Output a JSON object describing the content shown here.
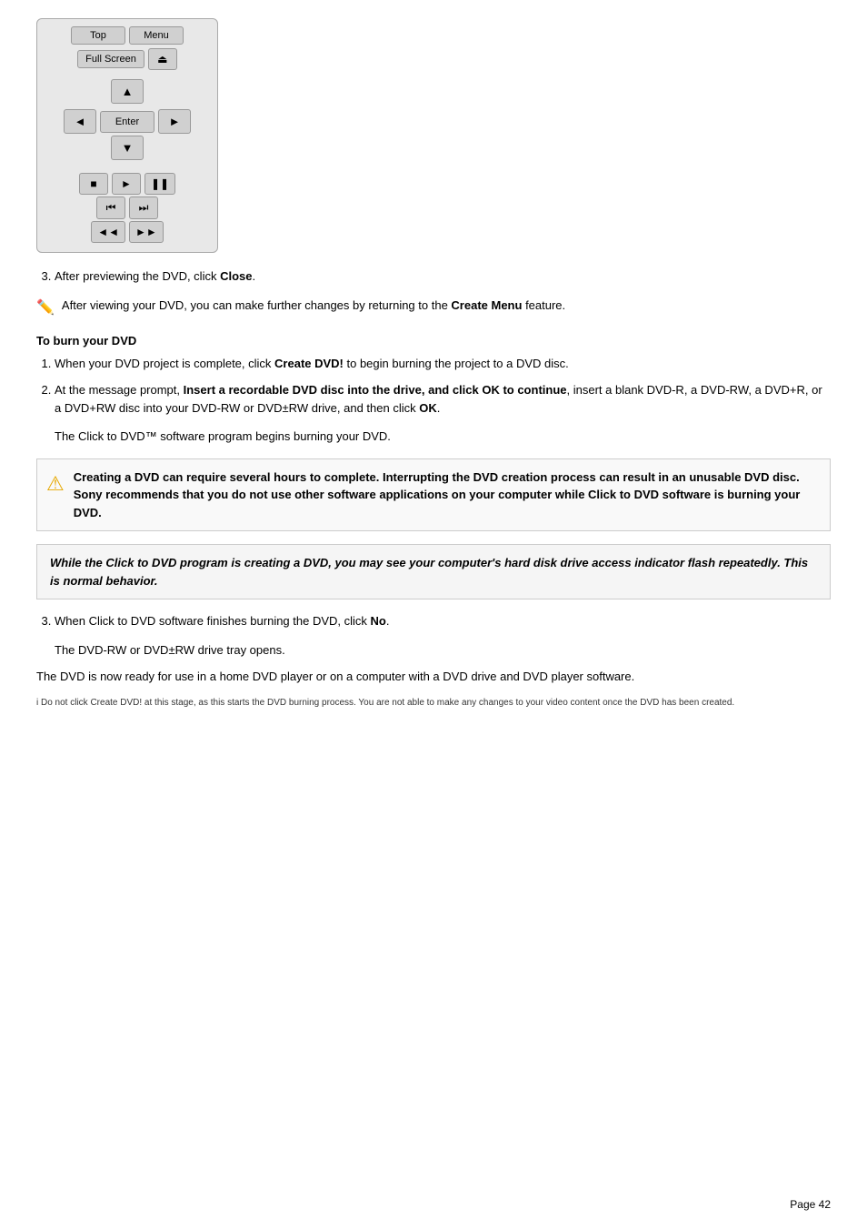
{
  "remote": {
    "btn_top": "Top",
    "btn_menu": "Menu",
    "btn_fullscreen": "Full Screen",
    "btn_eject": "⏏",
    "btn_up": "▲",
    "btn_left": "◄",
    "btn_enter": "Enter",
    "btn_right": "►",
    "btn_down": "▼",
    "btn_stop": "■",
    "btn_play": "►",
    "btn_pause": "❚❚",
    "btn_prev_chapter": "⏮",
    "btn_next_chapter": "⏭",
    "btn_rewind": "◄◄",
    "btn_ff": "►►"
  },
  "step3_label": "After previewing the DVD, click ",
  "step3_bold": "Close",
  "step3_end": ".",
  "note1_text": "After viewing your DVD, you can make further changes by returning to the ",
  "note1_bold": "Create Menu",
  "note1_end": " feature.",
  "section_heading": "To burn your DVD",
  "steps_burn": [
    {
      "text_before": "When your DVD project is complete, click ",
      "bold": "Create DVD!",
      "text_after": " to begin burning the project to a DVD disc."
    },
    {
      "text_before": "At the message prompt, ",
      "bold": "Insert a recordable DVD disc into the drive, and click OK to continue",
      "text_after": ", insert a blank DVD-R, a DVD-RW, a DVD+R, or a DVD+RW disc into your DVD-RW or DVD±RW drive, and then click ",
      "bold2": "OK",
      "text_end": "."
    }
  ],
  "click_to_dvd_para": "The Click to DVD™ software program begins burning your DVD.",
  "warning_text": "Creating a DVD can require several hours to complete. Interrupting the DVD creation process can result in an unusable DVD disc. Sony recommends that you do not use other software applications on your computer while Click to DVD software is burning your DVD.",
  "info_text": "While the Click to DVD program is creating a DVD, you may see your computer's hard disk drive access indicator flash repeatedly. This is normal behavior.",
  "step3_burn_before": "When Click to DVD software finishes burning the DVD, click ",
  "step3_burn_bold": "No",
  "step3_burn_end": ".",
  "drive_tray_text": "The DVD-RW or DVD±RW drive tray opens.",
  "final_para": "The DVD is now ready for use in a home DVD player or on a computer with a DVD drive and DVD player software.",
  "footnote": "i Do not click Create DVD! at this stage, as this starts the DVD burning process. You are not able to make any changes to your video content once the DVD has been created.",
  "page_label": "Page 42"
}
